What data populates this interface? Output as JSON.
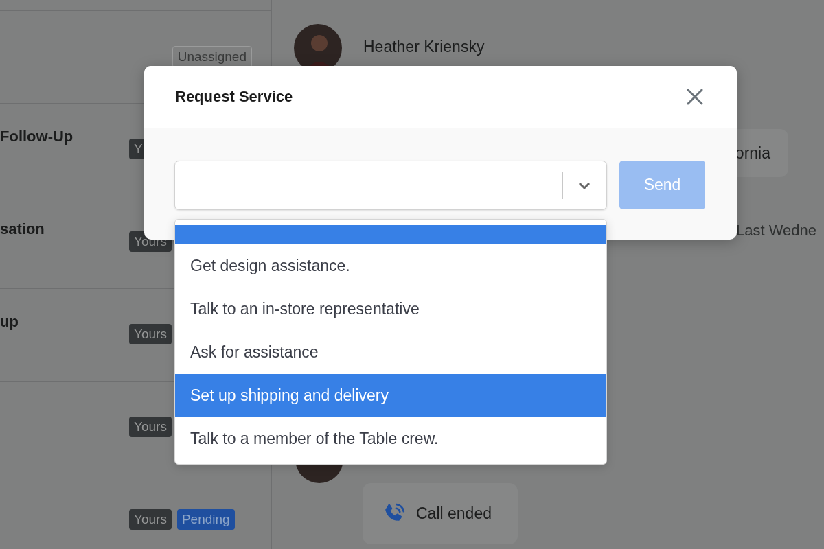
{
  "conversations": [
    {
      "badges": [
        {
          "kind": "outline",
          "label": "Unassigned"
        }
      ]
    },
    {
      "title": "Follow-Up",
      "badges": [
        {
          "kind": "dark",
          "label": "Y"
        }
      ]
    },
    {
      "title": "sation",
      "badges": [
        {
          "kind": "dark",
          "label": "Yours"
        }
      ]
    },
    {
      "title": "up",
      "badges": [
        {
          "kind": "dark",
          "label": "Yours"
        }
      ]
    },
    {
      "badges": [
        {
          "kind": "dark",
          "label": "Yours"
        }
      ]
    },
    {
      "badges": [
        {
          "kind": "dark",
          "label": "Yours"
        },
        {
          "kind": "blue",
          "label": "Pending"
        }
      ]
    }
  ],
  "chat": {
    "contact_name": "Heather Kriensky",
    "bubble_text": "ornia",
    "timestamp": "Last Wedne",
    "call_status": "Call ended"
  },
  "dialog": {
    "title": "Request Service",
    "send_button": {
      "label": "Send",
      "disabled": true
    },
    "dropdown": {
      "expanded": true,
      "top_row_highlighted": true,
      "options": [
        {
          "label": "Get design assistance.",
          "selected": false
        },
        {
          "label": "Talk to an in-store representative",
          "selected": false
        },
        {
          "label": "Ask for assistance",
          "selected": false
        },
        {
          "label": "Set up shipping and delivery",
          "selected": true
        },
        {
          "label": "Talk to a member of the Table crew.",
          "selected": false
        }
      ]
    }
  }
}
